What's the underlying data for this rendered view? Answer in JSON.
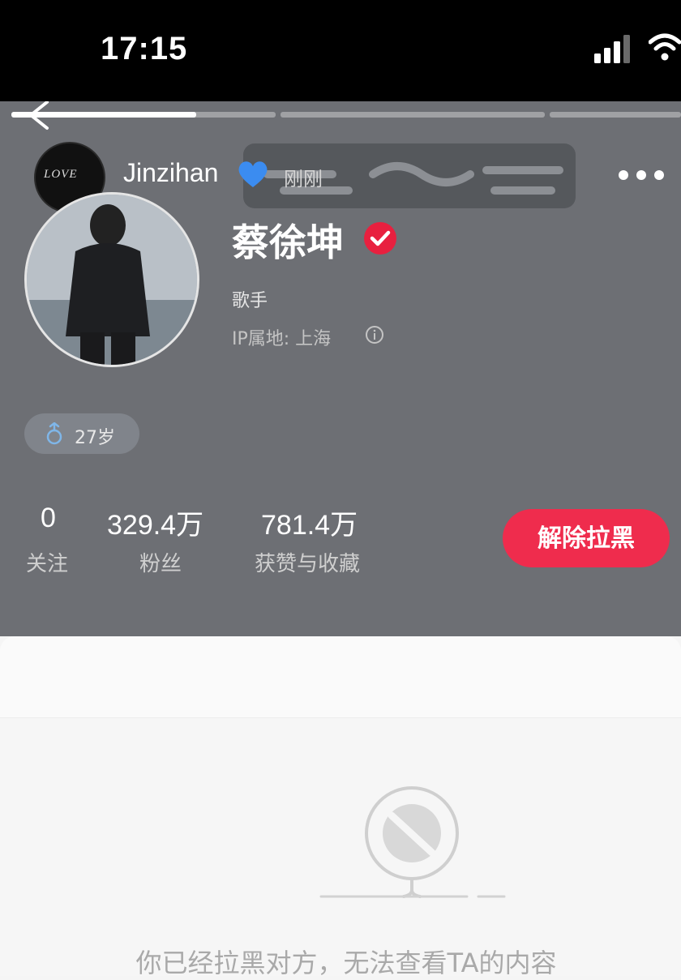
{
  "status_bar": {
    "time": "17:15",
    "signal_icon": "cellular-signal-icon",
    "wifi_icon": "wifi-icon"
  },
  "story": {
    "username": "Jinzihan",
    "emoji": "blue-heart-icon",
    "time": "刚刚",
    "avatar_text": "LOVE",
    "progress_fraction": 0.27
  },
  "profile": {
    "name": "蔡徐坤",
    "description": "歌手",
    "ip_location": "IP属地: 上海",
    "age_tag": "27岁",
    "stats": [
      {
        "value": "0",
        "label": "关注"
      },
      {
        "value": "329.4万",
        "label": "粉丝"
      },
      {
        "value": "781.4万",
        "label": "获赞与收藏"
      }
    ],
    "unblock_label": "解除拉黑"
  },
  "content": {
    "blocked_message": "你已经拉黑对方，无法查看TA的内容"
  },
  "colors": {
    "accent": "#ef2c4d",
    "header_bg": "#6d6f74",
    "verified": "#e8203f",
    "heart": "#3b8cf0"
  }
}
